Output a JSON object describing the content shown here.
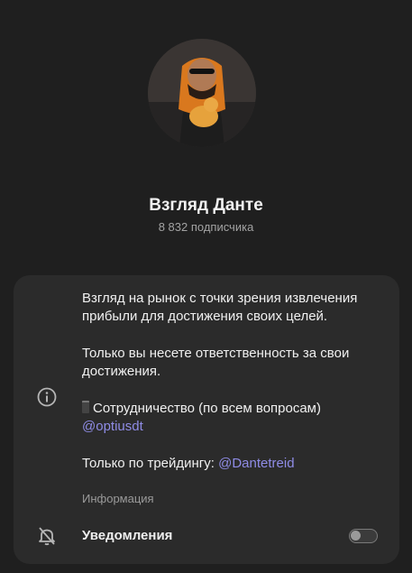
{
  "profile": {
    "name": "Взгляд Данте",
    "subscribers": "8 832 подписчика"
  },
  "about": {
    "line1": "Взгляд на рынок с точки зрения извлечения прибыли для достижения своих целей.",
    "line2": "Только вы несете ответственность за свои достижения.",
    "cooperation_text": "Сотрудничество (по всем вопросам)",
    "cooperation_link": "@optiusdt",
    "trading_text": "Только по трейдингу: ",
    "trading_link": "@Dantetreid",
    "label": "Информация"
  },
  "notifications": {
    "label": "Уведомления",
    "enabled": false
  },
  "colors": {
    "background": "#1f1f1f",
    "card": "#2b2b2b",
    "link": "#8f8ce6"
  },
  "icons": [
    "info-icon",
    "bell-off-icon",
    "phone-icon"
  ]
}
